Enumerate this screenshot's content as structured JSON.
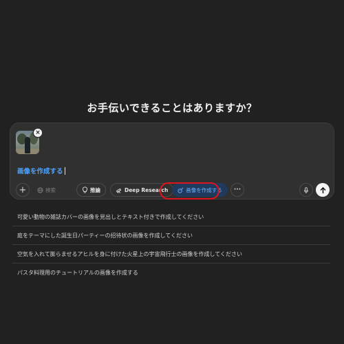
{
  "headline": "お手伝いできることはありますか？",
  "composer": {
    "prompt_text": "画像を作成する",
    "attachment": {
      "remove_label": "×"
    }
  },
  "toolbar": {
    "add_label": "+",
    "search_label": "検索",
    "reason_label": "推論",
    "deep_research_label": "Deep Research",
    "create_image_label": "画像を作成する",
    "more_label": "···"
  },
  "suggestions": [
    "可愛い動物の雑誌カバーの画像を見出しとテキスト付きで作成してください",
    "庭をテーマにした誕生日パーティーの招待状の画像を作成してください",
    "空気を入れて膨らませるアヒルを身に付けた火星上の宇宙飛行士の画像を作成してください",
    "パスタ料理用のチュートリアルの画像を作成する"
  ],
  "colors": {
    "background": "#212121",
    "composer": "#303030",
    "accent": "#4ea3ff",
    "active_tool_bg": "#1f3a5c",
    "highlight_ring": "#e0141e"
  }
}
